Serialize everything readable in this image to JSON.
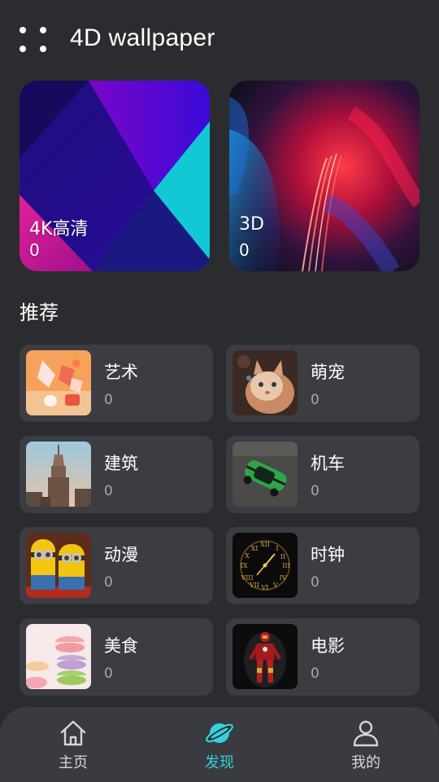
{
  "header": {
    "title": "4D wallpaper",
    "menu_icon": "grid-dots-icon"
  },
  "featured": [
    {
      "title": "4K高清",
      "count": "0"
    },
    {
      "title": "3D",
      "count": "0"
    }
  ],
  "section": {
    "title": "推荐"
  },
  "categories": [
    {
      "name": "艺术",
      "count": "0",
      "icon": "art-thumbnail"
    },
    {
      "name": "萌宠",
      "count": "0",
      "icon": "cat-thumbnail"
    },
    {
      "name": "建筑",
      "count": "0",
      "icon": "skyscraper-thumbnail"
    },
    {
      "name": "机车",
      "count": "0",
      "icon": "green-car-thumbnail"
    },
    {
      "name": "动漫",
      "count": "0",
      "icon": "minions-thumbnail"
    },
    {
      "name": "时钟",
      "count": "0",
      "icon": "clock-thumbnail"
    },
    {
      "name": "美食",
      "count": "0",
      "icon": "macarons-thumbnail"
    },
    {
      "name": "电影",
      "count": "0",
      "icon": "ironman-thumbnail"
    }
  ],
  "nav": {
    "items": [
      {
        "label": "主页",
        "icon": "home-icon"
      },
      {
        "label": "发现",
        "icon": "planet-icon",
        "active": true
      },
      {
        "label": "我的",
        "icon": "user-icon"
      }
    ]
  },
  "colors": {
    "background": "#2b2c30",
    "card": "#3c3d42",
    "accent": "#35d1df",
    "nav_bar": "#3a3b40"
  }
}
